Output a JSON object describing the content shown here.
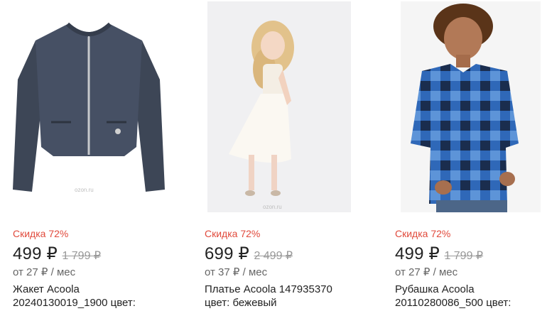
{
  "products": [
    {
      "image_alt": "jacket-image",
      "watermark": "ozon.ru",
      "discount": "Скидка 72%",
      "price": "499 ₽",
      "old_price": "1 799 ₽",
      "monthly": "от 27 ₽ / мес",
      "title": "Жакет Acoola\n20240130019_1900 цвет:"
    },
    {
      "image_alt": "dress-image",
      "watermark": "ozon.ru",
      "discount": "Скидка 72%",
      "price": "699 ₽",
      "old_price": "2 499 ₽",
      "monthly": "от 37 ₽ / мес",
      "title": "Платье Acoola 147935370\nцвет: бежевый"
    },
    {
      "image_alt": "shirt-image",
      "discount": "Скидка 72%",
      "price": "499 ₽",
      "old_price": "1 799 ₽",
      "monthly": "от 27 ₽ / мес",
      "title": "Рубашка Acoola\n20110280086_500 цвет:"
    }
  ],
  "colors": {
    "discount": "#e14a3c",
    "old_price": "#999999",
    "monthly": "#666666"
  }
}
